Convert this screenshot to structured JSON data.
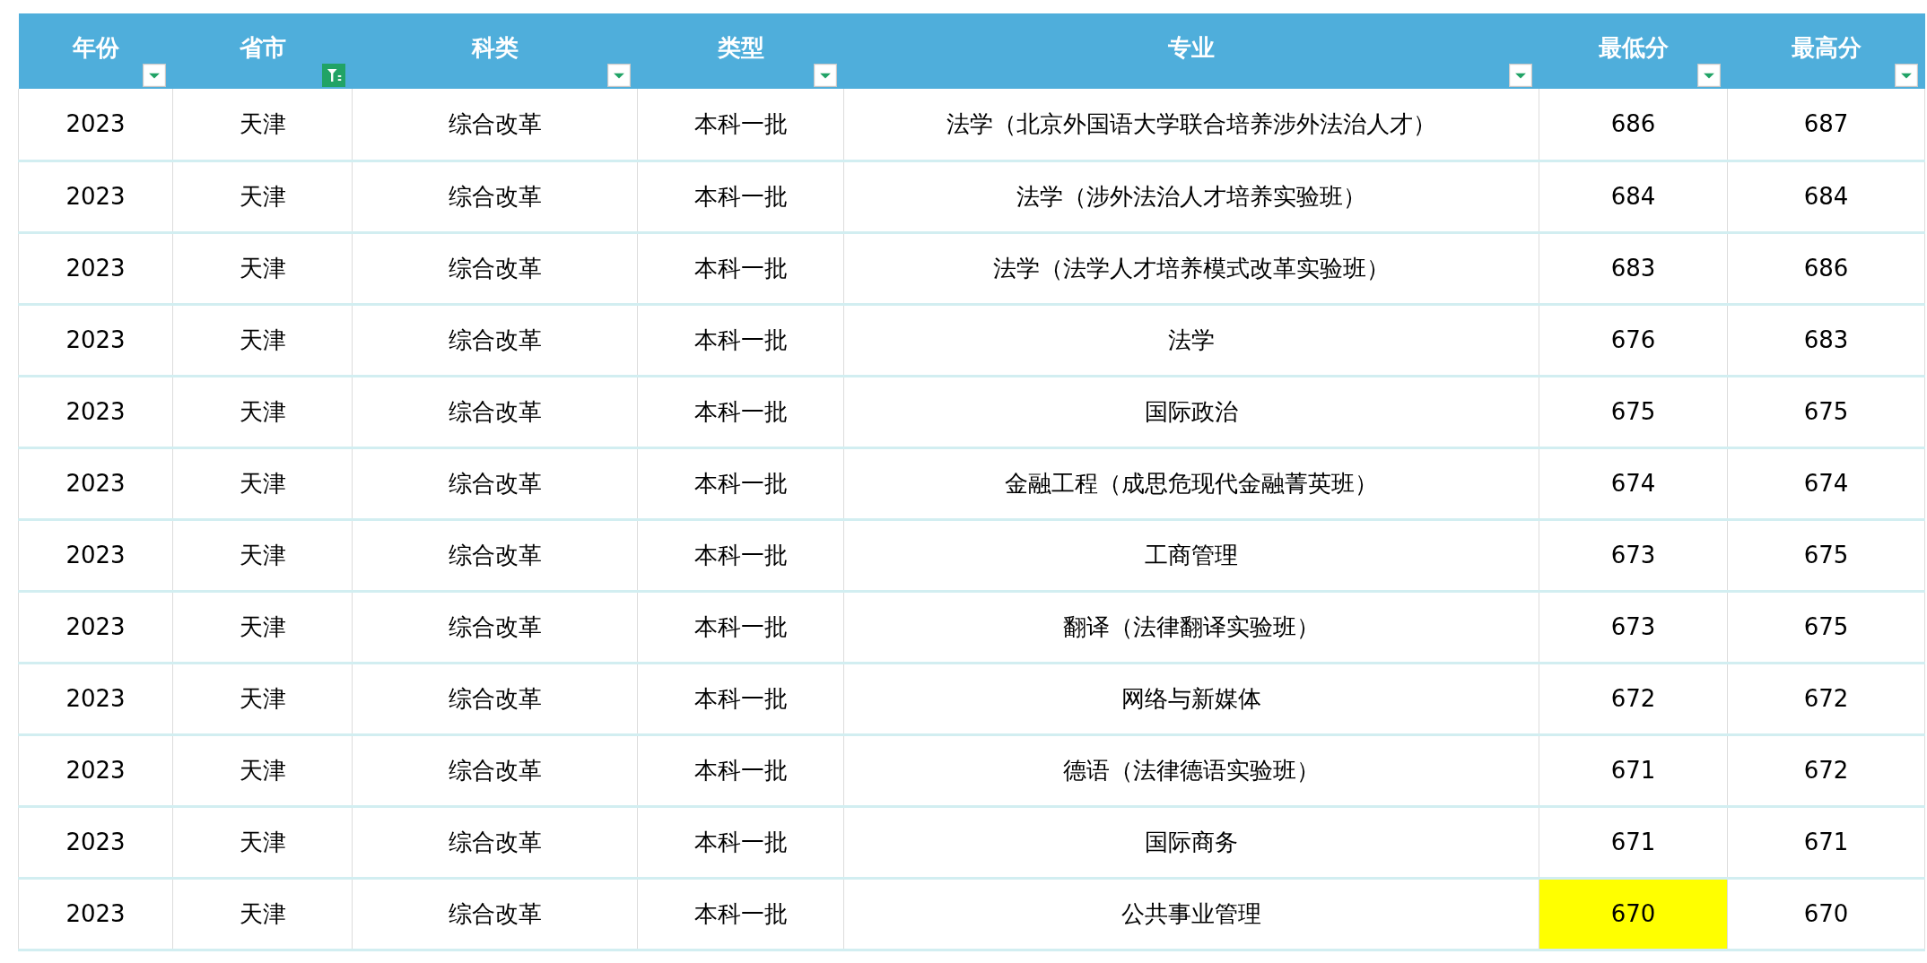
{
  "table": {
    "columns": [
      {
        "label": "年份",
        "kind": "dropdown"
      },
      {
        "label": "省市",
        "kind": "filtered"
      },
      {
        "label": "科类",
        "kind": "dropdown"
      },
      {
        "label": "类型",
        "kind": "dropdown"
      },
      {
        "label": "专业",
        "kind": "dropdown"
      },
      {
        "label": "最低分",
        "kind": "dropdown"
      },
      {
        "label": "最高分",
        "kind": "dropdown"
      }
    ],
    "rows": [
      {
        "cells": [
          "2023",
          "天津",
          "综合改革",
          "本科一批",
          "法学（北京外国语大学联合培养涉外法治人才）",
          "686",
          "687"
        ],
        "min_highlighted": false
      },
      {
        "cells": [
          "2023",
          "天津",
          "综合改革",
          "本科一批",
          "法学（涉外法治人才培养实验班）",
          "684",
          "684"
        ],
        "min_highlighted": false
      },
      {
        "cells": [
          "2023",
          "天津",
          "综合改革",
          "本科一批",
          "法学（法学人才培养模式改革实验班）",
          "683",
          "686"
        ],
        "min_highlighted": false
      },
      {
        "cells": [
          "2023",
          "天津",
          "综合改革",
          "本科一批",
          "法学",
          "676",
          "683"
        ],
        "min_highlighted": false
      },
      {
        "cells": [
          "2023",
          "天津",
          "综合改革",
          "本科一批",
          "国际政治",
          "675",
          "675"
        ],
        "min_highlighted": false
      },
      {
        "cells": [
          "2023",
          "天津",
          "综合改革",
          "本科一批",
          "金融工程（成思危现代金融菁英班）",
          "674",
          "674"
        ],
        "min_highlighted": false
      },
      {
        "cells": [
          "2023",
          "天津",
          "综合改革",
          "本科一批",
          "工商管理",
          "673",
          "675"
        ],
        "min_highlighted": false
      },
      {
        "cells": [
          "2023",
          "天津",
          "综合改革",
          "本科一批",
          "翻译（法律翻译实验班）",
          "673",
          "675"
        ],
        "min_highlighted": false
      },
      {
        "cells": [
          "2023",
          "天津",
          "综合改革",
          "本科一批",
          "网络与新媒体",
          "672",
          "672"
        ],
        "min_highlighted": false
      },
      {
        "cells": [
          "2023",
          "天津",
          "综合改革",
          "本科一批",
          "德语（法律德语实验班）",
          "671",
          "672"
        ],
        "min_highlighted": false
      },
      {
        "cells": [
          "2023",
          "天津",
          "综合改革",
          "本科一批",
          "国际商务",
          "671",
          "671"
        ],
        "min_highlighted": false
      },
      {
        "cells": [
          "2023",
          "天津",
          "综合改革",
          "本科一批",
          "公共事业管理",
          "670",
          "670"
        ],
        "min_highlighted": true
      }
    ]
  }
}
